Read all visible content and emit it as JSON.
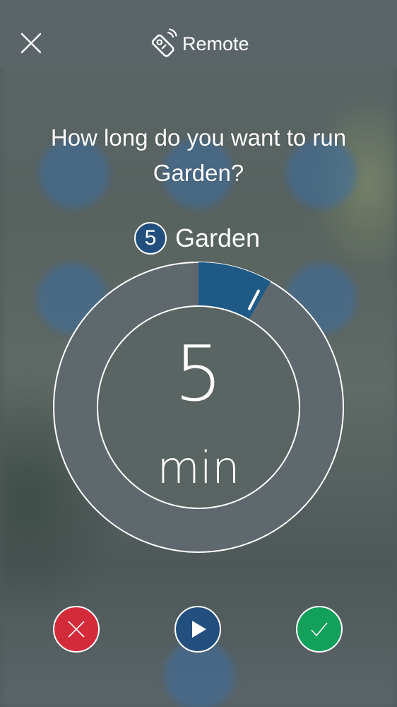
{
  "header": {
    "title": "Remote",
    "close_icon": "close-icon",
    "title_icon": "remote-icon"
  },
  "question": {
    "line1": "How long do you want to run",
    "line2": "Garden?"
  },
  "zone": {
    "number": "5",
    "name": "Garden"
  },
  "timer": {
    "value": "5",
    "unit": "min",
    "fill_fraction": 0.083
  },
  "actions": {
    "cancel_icon": "close-icon",
    "play_icon": "play-icon",
    "confirm_icon": "check-icon"
  },
  "colors": {
    "header_bg": "#5b6569",
    "dial_ring": "#5e686d",
    "dial_fill": "#1f5a86",
    "cancel": "#d42b3a",
    "play": "#234f7e",
    "confirm": "#12a05a"
  }
}
